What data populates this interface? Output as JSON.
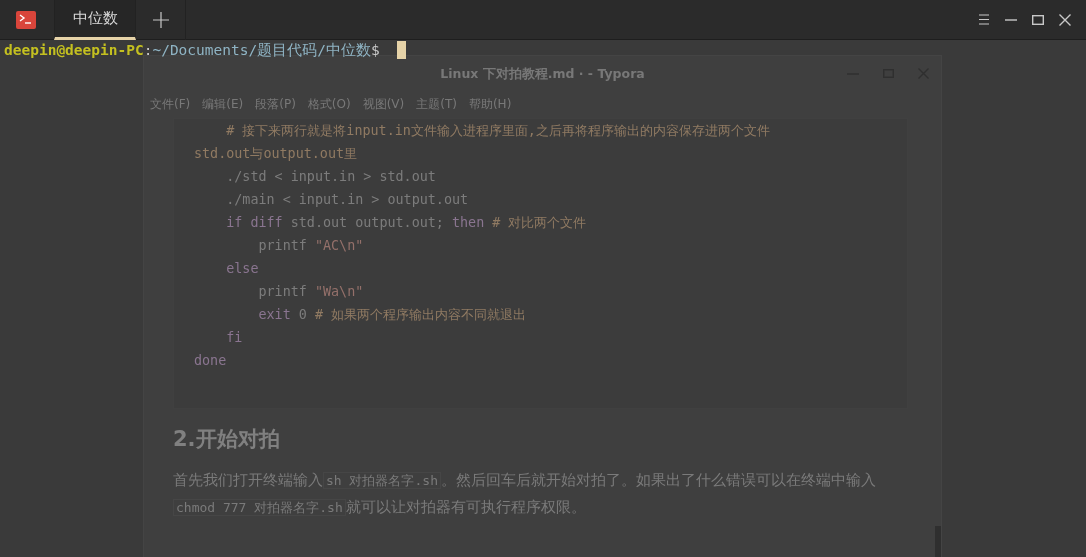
{
  "terminal": {
    "tabs": [
      {
        "label": "中位数",
        "selected": true
      }
    ],
    "prompt": {
      "user_host": "deepin@deepin-PC",
      "separator": ":",
      "path": "~/Documents/题目代码/中位数",
      "symbol": "$"
    }
  },
  "background_window": {
    "title": "Linux 下对拍教程.md · - Typora",
    "menu": [
      "文件(F)",
      "编辑(E)",
      "段落(P)",
      "格式(O)",
      "视图(V)",
      "主题(T)",
      "帮助(H)"
    ],
    "code_lines": [
      [
        {
          "kind": "comment",
          "text": "    # 接下来两行就是将input.in文件输入进程序里面,之后再将程序输出的内容保存进两个文件"
        }
      ],
      [
        {
          "kind": "comment",
          "text": "std.out与output.out里"
        }
      ],
      [
        {
          "kind": "plain",
          "text": "    ./std < input.in > std.out"
        }
      ],
      [
        {
          "kind": "plain",
          "text": "    ./main < input.in > output.out"
        }
      ],
      [
        {
          "kind": "keyword",
          "text": "    if "
        },
        {
          "kind": "keyword",
          "text": "diff"
        },
        {
          "kind": "plain",
          "text": " std.out output.out; "
        },
        {
          "kind": "keyword",
          "text": "then"
        },
        {
          "kind": "comment",
          "text": " # 对比两个文件"
        }
      ],
      [
        {
          "kind": "plain",
          "text": "        printf "
        },
        {
          "kind": "string",
          "text": "\"AC\\n\""
        }
      ],
      [
        {
          "kind": "keyword",
          "text": "    else"
        }
      ],
      [
        {
          "kind": "plain",
          "text": "        printf "
        },
        {
          "kind": "string",
          "text": "\"Wa\\n\""
        }
      ],
      [
        {
          "kind": "keyword",
          "text": "        exit"
        },
        {
          "kind": "plain",
          "text": " 0 "
        },
        {
          "kind": "comment",
          "text": "# 如果两个程序输出内容不同就退出"
        }
      ],
      [
        {
          "kind": "keyword",
          "text": "    fi"
        }
      ],
      [
        {
          "kind": "keyword",
          "text": "done"
        }
      ]
    ],
    "heading": "2.开始对拍",
    "paragraph": [
      {
        "kind": "text",
        "text": "首先我们打开终端输入"
      },
      {
        "kind": "code",
        "text": "sh  对拍器名字.sh"
      },
      {
        "kind": "text",
        "text": "。然后回车后就开始对拍了。如果出了什么错误可以在终端中输入"
      },
      {
        "kind": "code",
        "text": "chmod 777 对拍器名字.sh"
      },
      {
        "kind": "text",
        "text": "就可以让对拍器有可执行程序权限。"
      }
    ]
  }
}
